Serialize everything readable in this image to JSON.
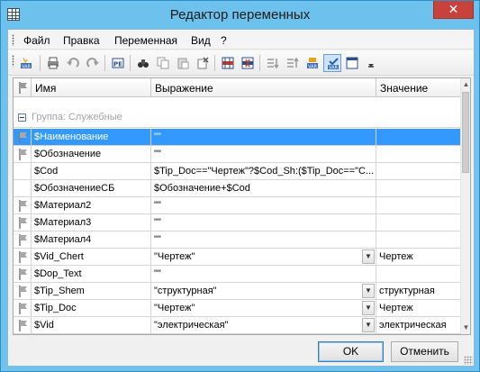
{
  "window": {
    "title": "Редактор переменных",
    "close_glyph": "✕"
  },
  "menu": [
    "Файл",
    "Правка",
    "Переменная",
    "Вид",
    "?"
  ],
  "toolbar": {
    "icons": [
      "var-add-icon",
      "print-icon",
      "undo-icon",
      "redo-icon",
      "properties-icon",
      "find-icon",
      "copy-icon",
      "paste-icon",
      "delete-icon",
      "insert-row-icon",
      "delete-row-icon",
      "move-down-icon",
      "move-up-icon",
      "var-settings-icon",
      "var-check-icon",
      "window-icon",
      "dropdown-icon"
    ]
  },
  "grid": {
    "columns": [
      "Имя",
      "Выражение",
      "Значение"
    ],
    "group_label": "Группа: Служебные",
    "rows": [
      {
        "flag": true,
        "name": "$Наименование",
        "expr": "\"\"",
        "value": "",
        "dropdown": false,
        "selected": true
      },
      {
        "flag": true,
        "name": "$Обозначение",
        "expr": "\"\"",
        "value": "",
        "dropdown": false,
        "selected": false
      },
      {
        "flag": false,
        "name": "$Cod",
        "expr": "$Tip_Doc==\"Чертеж\"?$Cod_Sh:($Tip_Doc==\"С...",
        "value": "",
        "dropdown": false,
        "selected": false
      },
      {
        "flag": false,
        "name": "$ОбозначениеСБ",
        "expr": "$Обозначение+$Cod",
        "value": "",
        "dropdown": false,
        "selected": false
      },
      {
        "flag": true,
        "name": "$Материал2",
        "expr": "\"\"",
        "value": "",
        "dropdown": false,
        "selected": false
      },
      {
        "flag": true,
        "name": "$Материал3",
        "expr": "\"\"",
        "value": "",
        "dropdown": false,
        "selected": false
      },
      {
        "flag": true,
        "name": "$Материал4",
        "expr": "\"\"",
        "value": "",
        "dropdown": false,
        "selected": false
      },
      {
        "flag": true,
        "name": "$Vid_Chert",
        "expr": "\"Чертеж\"",
        "value": "Чертеж",
        "dropdown": true,
        "selected": false
      },
      {
        "flag": true,
        "name": "$Dop_Text",
        "expr": "\"\"",
        "value": "",
        "dropdown": false,
        "selected": false
      },
      {
        "flag": true,
        "name": "$Tip_Shem",
        "expr": "\"структурная\"",
        "value": "структурная",
        "dropdown": true,
        "selected": false
      },
      {
        "flag": true,
        "name": "$Tip_Doc",
        "expr": "\"Чертеж\"",
        "value": "Чертеж",
        "dropdown": true,
        "selected": false
      },
      {
        "flag": true,
        "name": "$Vid",
        "expr": "\"электрическая\"",
        "value": "электрическая",
        "dropdown": true,
        "selected": false
      }
    ]
  },
  "buttons": {
    "ok": "OK",
    "cancel": "Отменить"
  }
}
